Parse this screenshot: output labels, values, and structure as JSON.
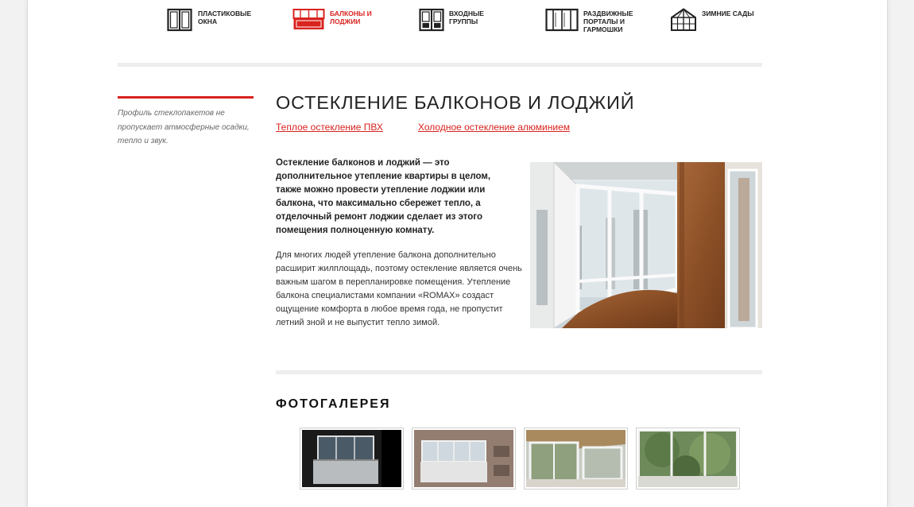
{
  "nav": {
    "items": [
      {
        "id": "plastic-windows",
        "label": "ПЛАСТИКОВЫЕ ОКНА",
        "icon": "window-icon"
      },
      {
        "id": "balconies",
        "label": "БАЛКОНЫ И ЛОДЖИИ",
        "icon": "balcony-icon"
      },
      {
        "id": "entrance",
        "label": "ВХОДНЫЕ ГРУППЫ",
        "icon": "door-icon"
      },
      {
        "id": "sliding",
        "label": "РАЗДВИЖНЫЕ ПОРТАЛЫ И ГАРМОШКИ",
        "icon": "sliding-portal-icon"
      },
      {
        "id": "winter-gardens",
        "label": "ЗИМНИЕ САДЫ",
        "icon": "winter-garden-icon"
      }
    ],
    "active": "balconies"
  },
  "sidebar": {
    "note": "Профиль стеклопакетов не пропускает атмосферные осадки, тепло и звук."
  },
  "main": {
    "title": "ОСТЕКЛЕНИЕ БАЛКОНОВ И ЛОДЖИЙ",
    "links": [
      "Теплое остекление ПВХ",
      "Холодное остекление алюминием"
    ],
    "intro": "Остекление балконов и лоджий — это дополнительное утепление квартиры в целом, также можно провести утепление лоджии или балкона, что максимально сбережет тепло, а отделочный ремонт лоджии сделает из этого помещения полноценную комнату.",
    "body": "Для многих людей утепление балкона дополнительно расширит жилплощадь, поэтому остекление является очень важным шагом в перепланировке помещения. Утепление балкона специалистами компании «ROMAX» создаст ощущение комфорта в любое время года, не пропустит летний зной и не выпустит тепло зимой."
  },
  "gallery": {
    "title": "ФОТОГАЛЕРЕЯ",
    "thumbs": [
      "thumb-1",
      "thumb-2",
      "thumb-3",
      "thumb-4"
    ]
  },
  "colors": {
    "accent": "#d9231f",
    "divider": "#eeeeee"
  }
}
